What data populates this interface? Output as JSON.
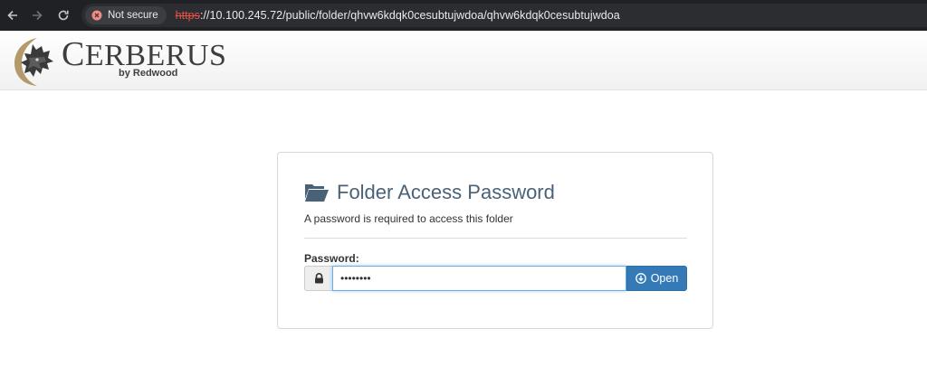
{
  "browser": {
    "security_label": "Not secure",
    "url_scheme": "https",
    "url_rest": "://10.100.245.72/public/folder/qhvw6kdqk0cesubtujwdoa/qhvw6kdqk0cesubtujwdoa"
  },
  "header": {
    "brand_first": "C",
    "brand_rest": "ERBERUS",
    "brand_sub": "by Redwood"
  },
  "card": {
    "title": "Folder Access Password",
    "subtitle": "A password is required to access this folder",
    "password_label": "Password:",
    "password_value": "••••••••",
    "open_label": "Open"
  },
  "colors": {
    "title": "#4a6277",
    "button": "#337ab7",
    "not_secure": "#e8504a"
  }
}
